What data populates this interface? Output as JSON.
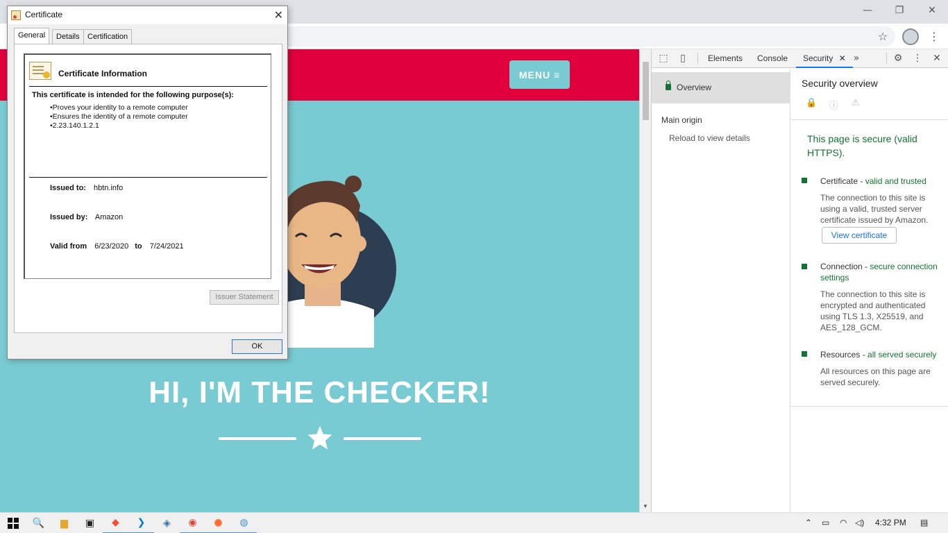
{
  "browser": {
    "window_controls": {
      "minimize": "—",
      "maximize": "❐",
      "close": "✕"
    },
    "bookmark_icon": "star-icon",
    "menu_icon": "vertical-dots-icon"
  },
  "page": {
    "menu_label": "MENU ≡",
    "hero_title": "HI, I'M THE CHECKER!",
    "colors": {
      "primary": "#e1003c",
      "accent": "#78cbd2"
    }
  },
  "devtools": {
    "tabs": [
      "Elements",
      "Console",
      "Security"
    ],
    "active_tab": "Security",
    "more_tabs": "»",
    "left": {
      "overview": "Overview",
      "main_origin": "Main origin",
      "reload_details": "Reload to view details"
    },
    "right": {
      "title": "Security overview",
      "secure_message": "This page is secure (valid HTTPS).",
      "certificate": {
        "head": "Certificate - ",
        "status": "valid and trusted",
        "desc": "The connection to this site is using a valid, trusted server certificate issued by Amazon.",
        "button": "View certificate"
      },
      "connection": {
        "head": "Connection - ",
        "status": "secure connection settings",
        "desc": "The connection to this site is encrypted and authenticated using TLS 1.3, X25519, and AES_128_GCM."
      },
      "resources": {
        "head": "Resources - ",
        "status": "all served securely",
        "desc": "All resources on this page are served securely."
      }
    }
  },
  "certificate_dialog": {
    "title": "Certificate",
    "close": "✕",
    "tabs": [
      "General",
      "Details",
      "Certification Path"
    ],
    "active_tab": "General",
    "info_title": "Certificate Information",
    "purpose_heading": "This certificate is intended for the following purpose(s):",
    "purposes": [
      "•Proves your identity to a remote computer",
      "•Ensures the identity of a remote computer",
      "•2.23.140.1.2.1"
    ],
    "issued_to_label": "Issued to:",
    "issued_to": "hbtn.info",
    "issued_by_label": "Issued by:",
    "issued_by": "Amazon",
    "valid_from_label": "Valid from",
    "valid_from": "6/23/2020",
    "to_label": "to",
    "valid_to": "7/24/2021",
    "issuer_statement": "Issuer Statement",
    "ok": "OK"
  },
  "taskbar": {
    "time": "4:32 PM"
  }
}
